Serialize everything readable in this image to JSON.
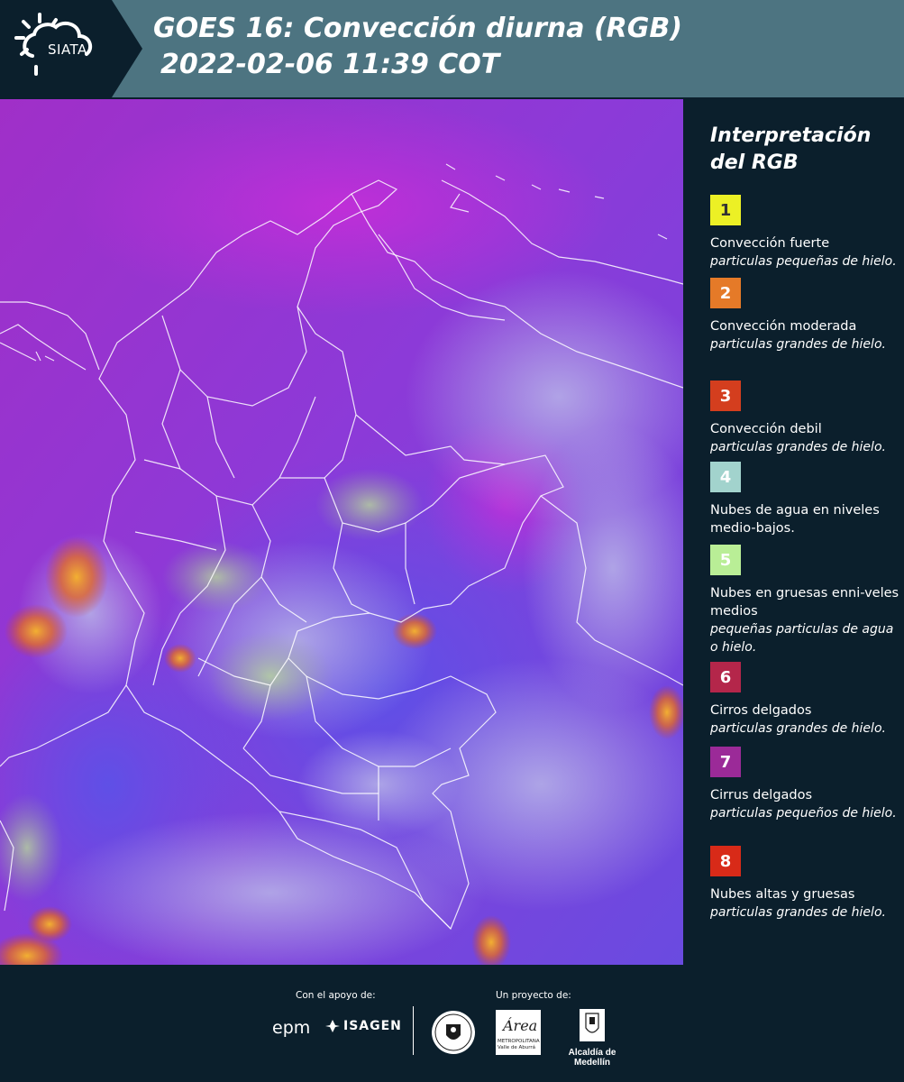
{
  "header": {
    "logo_text": "SIATA",
    "title_line1": "GOES 16: Convección diurna (RGB)",
    "title_line2": "2022-02-06 11:39 COT"
  },
  "legend": {
    "title": "Interpretación del RGB",
    "items": [
      {
        "number": "1",
        "color": "#ecf025",
        "text_color": "#333333",
        "label": "Convección fuerte",
        "desc": "particulas pequeñas de hielo."
      },
      {
        "number": "2",
        "color": "#e57a28",
        "text_color": "#ffffff",
        "label": "Convección moderada",
        "desc": "particulas grandes de hielo."
      },
      {
        "number": "3",
        "color": "#d43e1e",
        "text_color": "#ffffff",
        "label": "Convección debil",
        "desc": "particulas grandes de hielo."
      },
      {
        "number": "4",
        "color": "#a2d3cd",
        "text_color": "#ffffff",
        "label": "Nubes de agua en niveles medio-bajos.",
        "desc": ""
      },
      {
        "number": "5",
        "color": "#b9ee96",
        "text_color": "#ffffff",
        "label": "Nubes en gruesas enni-veles medios",
        "desc": "pequeñas particulas de agua o hielo."
      },
      {
        "number": "6",
        "color": "#b4264a",
        "text_color": "#ffffff",
        "label": "Cirros delgados",
        "desc": "particulas grandes de hielo."
      },
      {
        "number": "7",
        "color": "#9b2a98",
        "text_color": "#ffffff",
        "label": "Cirrus delgados",
        "desc": "particulas pequeños de hielo."
      },
      {
        "number": "8",
        "color": "#d82a18",
        "text_color": "#ffffff",
        "label": "Nubes altas y gruesas",
        "desc": "particulas grandes de hielo."
      }
    ]
  },
  "footer": {
    "support_label": "Con el apoyo de:",
    "project_label": "Un proyecto de:",
    "sponsor_1": "epm",
    "sponsor_2": "ISAGEN",
    "area_logo_word": "Área",
    "area_logo_sub": "METROPOLITANA Valle de Aburrá",
    "alcaldia": "Alcaldía de Medellín"
  },
  "colors": {
    "background": "#0b1f2c",
    "header_band": "#4d7481",
    "map_base": "#9a2dcf"
  }
}
